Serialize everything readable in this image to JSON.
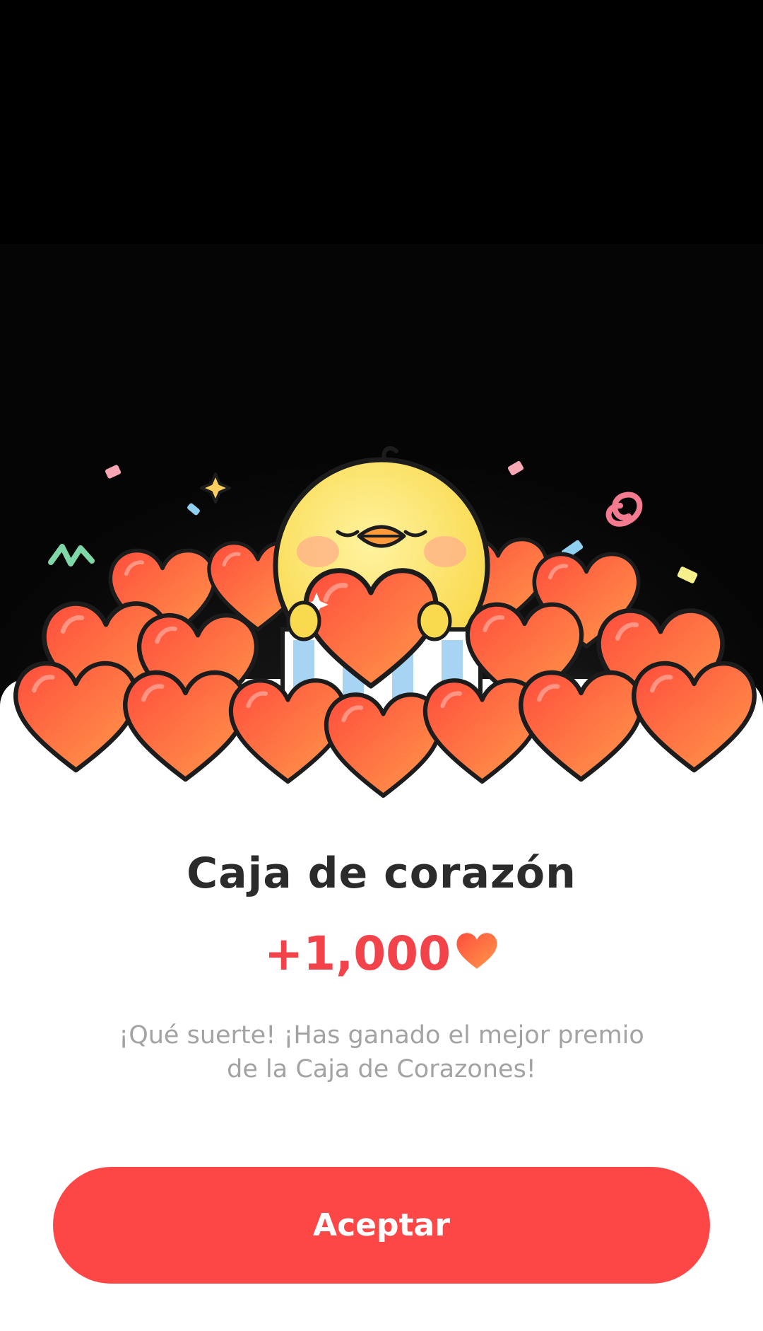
{
  "reward": {
    "title": "Caja de corazón",
    "amount": "+1,000",
    "amount_icon": "heart-icon",
    "message": "¡Qué suerte! ¡Has ganado el mejor premio de la Caja de Corazones!"
  },
  "actions": {
    "accept_label": "Aceptar"
  },
  "colors": {
    "accent": "#fd4747",
    "amount": "#f2434a",
    "title": "#2b2b2b",
    "message": "#a3a3a3",
    "sheet": "#ffffff"
  },
  "illustration": {
    "subject": "chick-holding-heart-icon",
    "decoration": "heart-pile-icon"
  }
}
